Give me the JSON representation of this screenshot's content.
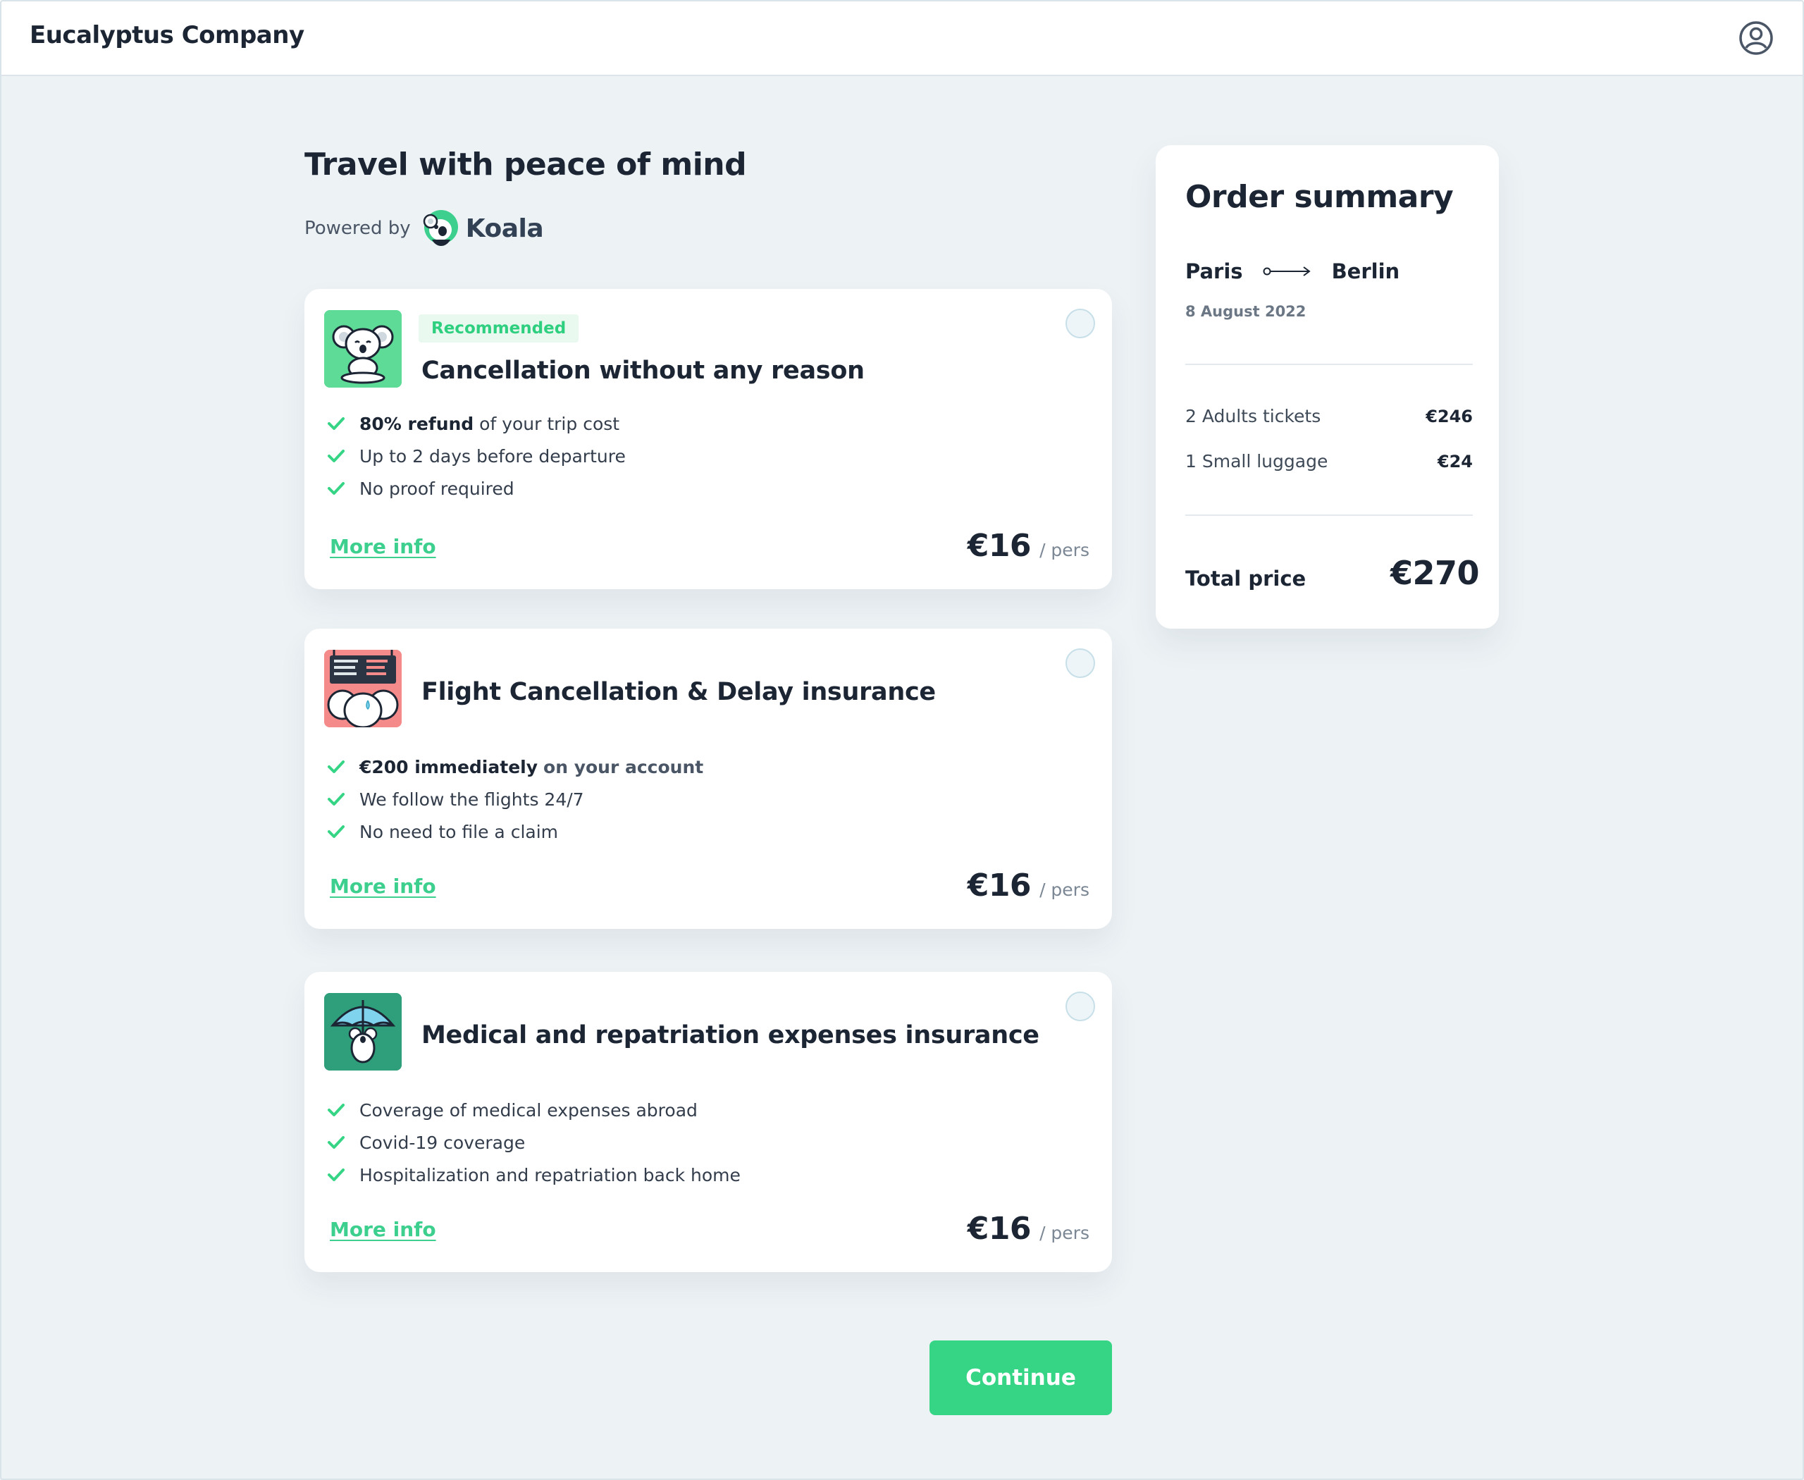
{
  "header": {
    "brand": "Eucalyptus Company",
    "user_icon": "user-circle-icon"
  },
  "page": {
    "title": "Travel with peace of mind",
    "powered_by_label": "Powered by",
    "partner_name": "Koala"
  },
  "offers": [
    {
      "badge": "Recommended",
      "title": "Cancellation without any reason",
      "icon": "koala-meditating-icon",
      "features": [
        {
          "bold": "80% refund",
          "text": " of your trip cost"
        },
        {
          "bold": "",
          "text": "Up to 2 days before departure"
        },
        {
          "bold": "",
          "text": "No proof required"
        }
      ],
      "more_info": "More info",
      "price": "€16",
      "unit": "/ pers",
      "selected": false
    },
    {
      "badge": "",
      "title": "Flight Cancellation & Delay insurance",
      "icon": "koala-departure-board-icon",
      "features": [
        {
          "bold": "€200 immediately",
          "text": "on your account"
        },
        {
          "bold": "",
          "text": "We follow the flights 24/7"
        },
        {
          "bold": "",
          "text": "No need to file a claim"
        }
      ],
      "more_info": "More info",
      "price": "€16",
      "unit": "/ pers",
      "selected": false
    },
    {
      "badge": "",
      "title": "Medical and repatriation expenses insurance",
      "icon": "koala-umbrella-icon",
      "features": [
        {
          "bold": "",
          "text": "Coverage of medical expenses abroad"
        },
        {
          "bold": "",
          "text": "Covid-19 coverage"
        },
        {
          "bold": "",
          "text": "Hospitalization and repatriation back home"
        }
      ],
      "more_info": "More info",
      "price": "€16",
      "unit": "/ pers",
      "selected": false
    }
  ],
  "continue_label": "Continue",
  "summary": {
    "title": "Order summary",
    "from": "Paris",
    "to": "Berlin",
    "date": "8 August 2022",
    "items": [
      {
        "label": "2 Adults tickets",
        "amount": "€246"
      },
      {
        "label": "1 Small luggage",
        "amount": "€24"
      }
    ],
    "total_label": "Total price",
    "total_amount": "€270"
  },
  "colors": {
    "accent": "#35d585",
    "link": "#3ccf8e",
    "text": "#1c2533",
    "background": "#edf2f5"
  }
}
